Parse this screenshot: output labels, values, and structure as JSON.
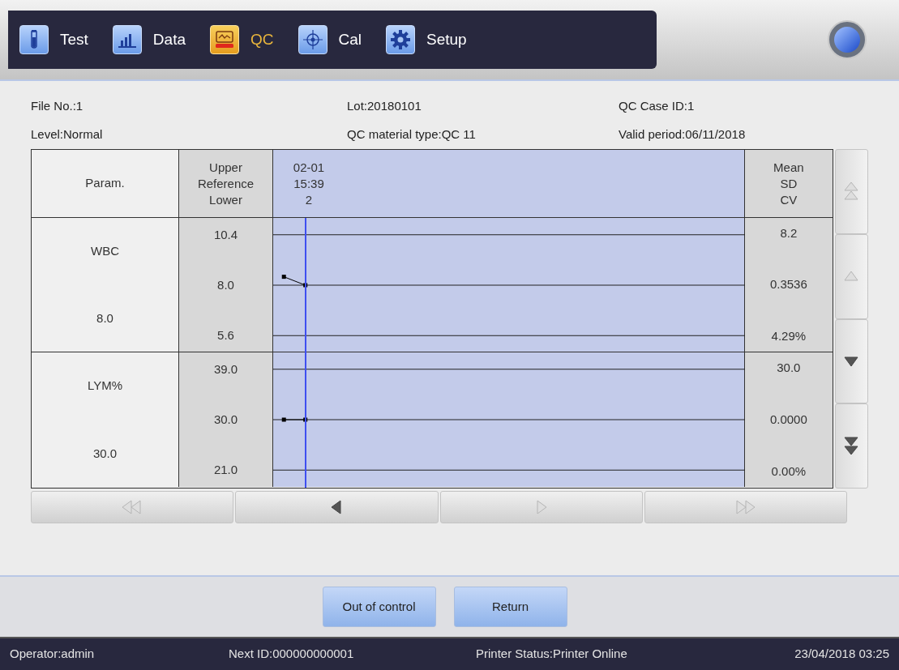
{
  "nav": [
    {
      "kind": "test",
      "label": "Test",
      "selected": false
    },
    {
      "kind": "data",
      "label": "Data",
      "selected": false
    },
    {
      "kind": "qc",
      "label": "QC",
      "selected": true
    },
    {
      "kind": "cal",
      "label": "Cal",
      "selected": false
    },
    {
      "kind": "setup",
      "label": "Setup",
      "selected": false
    }
  ],
  "info": [
    [
      "File No.:1",
      "Lot:20180101",
      "QC Case ID:1"
    ],
    [
      "Level:Normal",
      "QC material type:QC 11",
      "Valid period:06/11/2018"
    ]
  ],
  "table": {
    "header": {
      "param": "Param.",
      "reference": [
        "Upper",
        "Reference",
        "Lower"
      ],
      "point": [
        "02-01",
        "15:39",
        "2"
      ],
      "stats": [
        "Mean",
        "SD",
        "CV"
      ]
    },
    "rows": [
      {
        "target": "8.0",
        "stats": [
          "8.2",
          "0.3536",
          "4.29%"
        ],
        "chart_data": {
          "type": "line",
          "categories": [
            null,
            null,
            null,
            null,
            null,
            null,
            null,
            null,
            null,
            null,
            null,
            null,
            null,
            null,
            null,
            null,
            null,
            null,
            null,
            null,
            null,
            null
          ],
          "grid": true,
          "series": [
            {
              "name": "WBC",
              "color": "#000000",
              "marker": "square",
              "values": [
                8.4,
                8.0,
                null,
                null,
                null,
                null,
                null,
                null,
                null,
                null,
                null,
                null,
                null,
                null,
                null,
                null,
                null,
                null,
                null,
                null,
                null,
                null
              ]
            }
          ],
          "ylim": [
            4.8,
            11.2
          ],
          "yticks": [
            {
              "value": 10.4,
              "label": "10.4"
            },
            {
              "value": 8.0,
              "label": "8.0"
            },
            {
              "value": 5.6,
              "label": "5.6"
            }
          ]
        }
      },
      {
        "target": "30.0",
        "stats": [
          "30.0",
          "0.0000",
          "0.00%"
        ],
        "chart_data": {
          "type": "line",
          "categories": [
            null,
            null,
            null,
            null,
            null,
            null,
            null,
            null,
            null,
            null,
            null,
            null,
            null,
            null,
            null,
            null,
            null,
            null,
            null,
            null,
            null,
            null
          ],
          "grid": true,
          "series": [
            {
              "name": "LYM%",
              "color": "#000000",
              "marker": "square",
              "values": [
                30.0,
                30.0,
                null,
                null,
                null,
                null,
                null,
                null,
                null,
                null,
                null,
                null,
                null,
                null,
                null,
                null,
                null,
                null,
                null,
                null,
                null,
                null
              ]
            }
          ],
          "ylim": [
            18.0,
            42.0
          ],
          "yticks": [
            {
              "value": 39.0,
              "label": "39.0"
            },
            {
              "value": 30.0,
              "label": "30.0"
            },
            {
              "value": 21.0,
              "label": "21.0"
            }
          ]
        }
      }
    ]
  },
  "scroll_buttons": [
    {
      "kind": "page-up",
      "disabled": true
    },
    {
      "kind": "up",
      "disabled": true
    },
    {
      "kind": "down",
      "disabled": false
    },
    {
      "kind": "page-down",
      "disabled": false
    }
  ],
  "point_buttons": [
    {
      "kind": "first",
      "disabled": true
    },
    {
      "kind": "prev",
      "disabled": false
    },
    {
      "kind": "next",
      "disabled": true
    },
    {
      "kind": "last",
      "disabled": true
    }
  ],
  "buttons": [
    "Out of control",
    "Return"
  ],
  "status_bar": [
    "Operator:admin",
    "Next ID:000000000001",
    "Printer Status:Printer Online",
    "23/04/2018 03:25"
  ]
}
